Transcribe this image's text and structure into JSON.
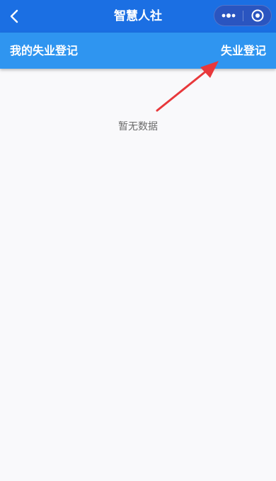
{
  "nav": {
    "title": "智慧人社",
    "back_icon": "chevron-left-icon",
    "more_icon": "more-dots-icon",
    "close_icon": "target-circle-icon"
  },
  "header": {
    "title": "我的失业登记",
    "action_label": "失业登记"
  },
  "content": {
    "empty_text": "暂无数据"
  },
  "colors": {
    "nav_background": "#1b6fe3",
    "header_background": "#2f95f0",
    "page_background": "#f9f9fb",
    "annotation_arrow": "#e8383b"
  }
}
